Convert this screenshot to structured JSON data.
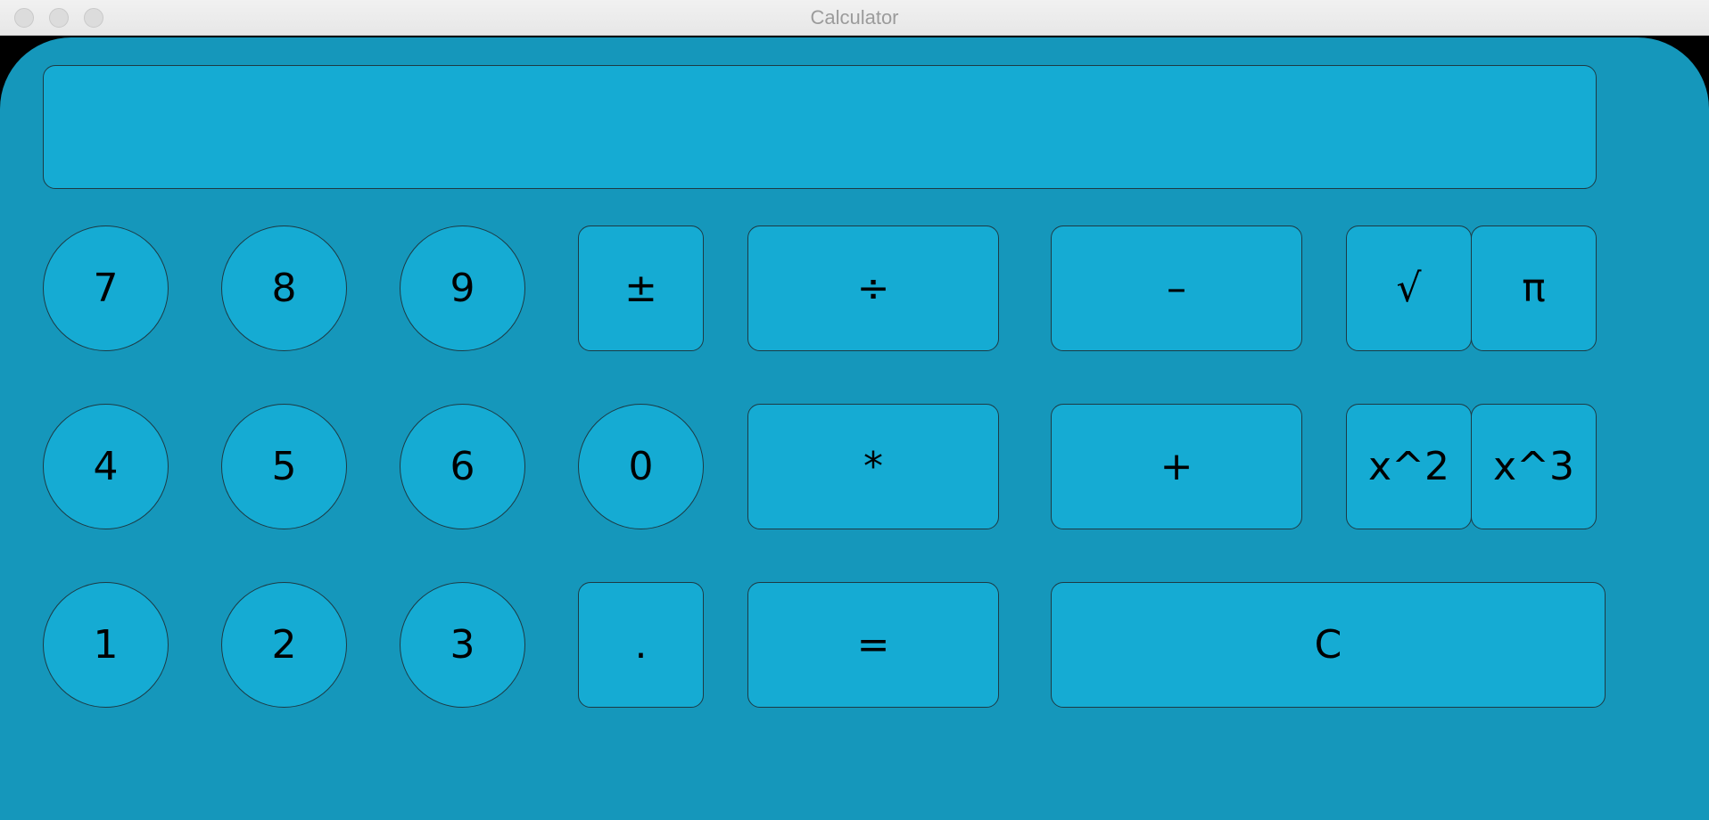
{
  "window": {
    "title": "Calculator"
  },
  "display": {
    "value": ""
  },
  "keys": {
    "seven": "7",
    "eight": "8",
    "nine": "9",
    "four": "4",
    "five": "5",
    "six": "6",
    "one": "1",
    "two": "2",
    "three": "3",
    "zero": "0",
    "plus_minus": "±",
    "decimal": ".",
    "divide": "÷",
    "multiply": "*",
    "equals": "=",
    "subtract": "–",
    "add": "+",
    "clear": "C",
    "sqrt": "√",
    "pi": "π",
    "square": "x^2",
    "cube": "x^3"
  },
  "colors": {
    "body": "#1597bb",
    "key_fill": "#15abd3",
    "key_border": "#1d3a44"
  }
}
